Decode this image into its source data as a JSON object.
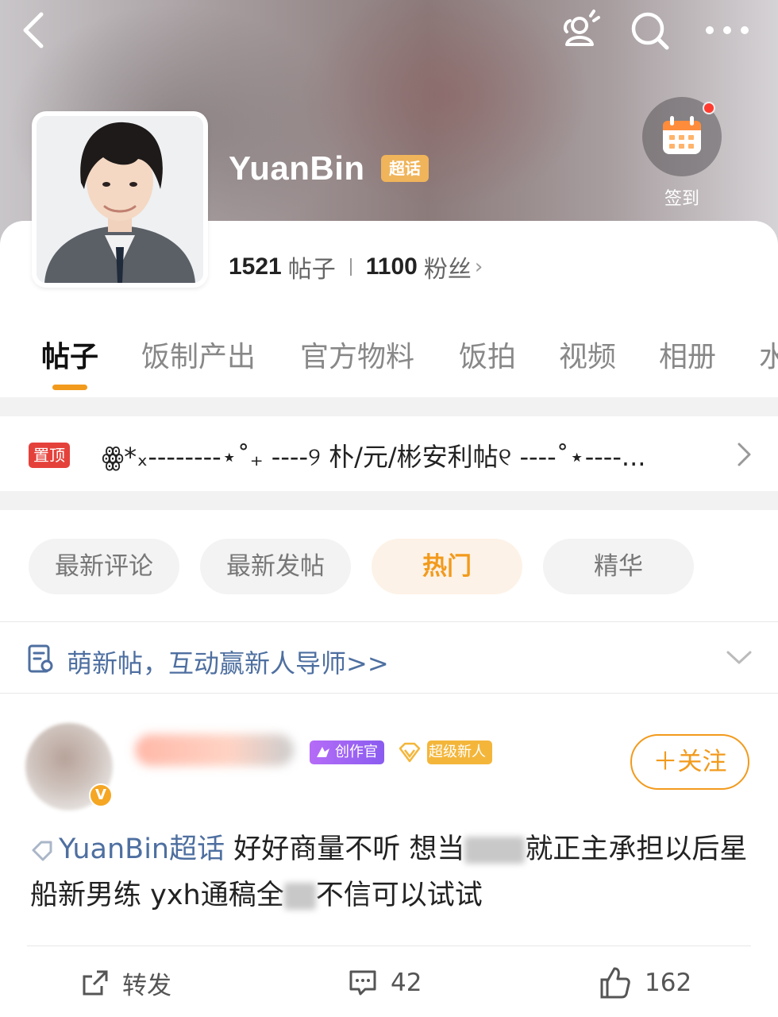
{
  "colors": {
    "accent": "#f29a1c",
    "link": "#4e6fa0",
    "pin_badge": "#e5413b",
    "topic_tag": "#f0b45b"
  },
  "topbar": {
    "back_icon": "chevron-left-icon",
    "friends_icon": "friends-icon",
    "search_icon": "search-icon",
    "more_icon": "more-icon"
  },
  "profile": {
    "name": "YuanBin",
    "tag": "超话",
    "posts_count": "1521",
    "posts_unit": "帖子",
    "fans_count": "1100",
    "fans_unit": "粉丝",
    "checkin_label": "签到"
  },
  "tabs": [
    "帖子",
    "饭制产出",
    "官方物料",
    "饭拍",
    "视频",
    "相册",
    "水"
  ],
  "pinned": {
    "badge": "置顶",
    "title": "ꙮ*ₓ--------⋆˚₊ ----୨ 朴/元/彬安利帖୧ ----˚⋆----..."
  },
  "sort": [
    "最新评论",
    "最新发帖",
    "热门",
    "精华"
  ],
  "notice": {
    "text": "萌新帖，互动赢新人导师>>"
  },
  "post": {
    "badges": [
      "创作官",
      "超级新人"
    ],
    "follow_label": "＋关注",
    "verified": "V",
    "topic": "YuanBin超话",
    "text_1": "好好商量不听 想当",
    "text_2": "就正主承担以后星船新男练 yxh通稿全",
    "text_3": "不信可以试试",
    "actions": {
      "repost": "转发",
      "comments": "42",
      "likes": "162"
    }
  }
}
